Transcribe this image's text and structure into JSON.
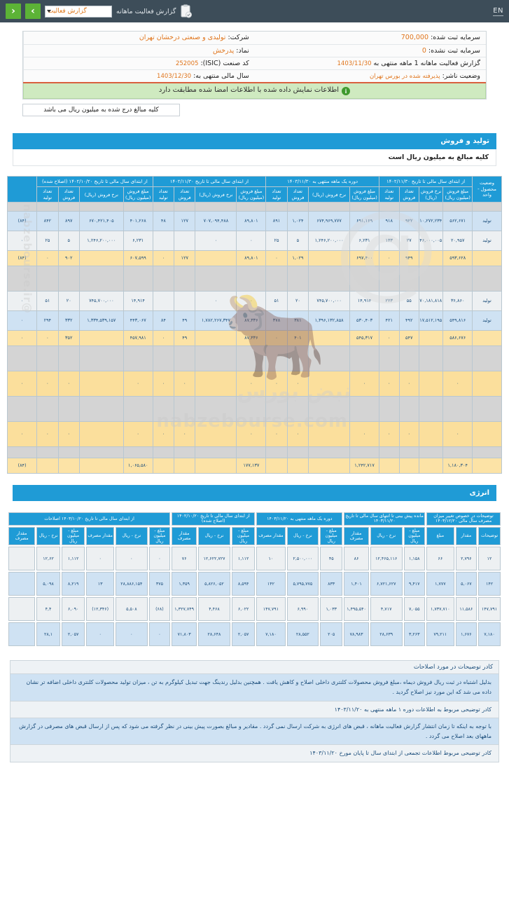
{
  "topbar": {
    "en_label": "EN",
    "title": "گزارش فعالیت ماهانه",
    "select_value": "گزارش فعالیت",
    "prev_label": "‹",
    "next_label": "›",
    "clipboard_icon": "clipboard-check-icon"
  },
  "info": {
    "company_label": "شرکت:",
    "company_value": "تولیدی و صنعتی درخشان تهران",
    "symbol_label": "نماد:",
    "symbol_value": "پدرخش",
    "isic_label": "کد صنعت (ISIC):",
    "isic_value": "252005",
    "fiscal_year_label": "سال مالی منتهی به:",
    "fiscal_year_value": "1403/12/30",
    "registered_capital_label": "سرمایه ثبت شده:",
    "registered_capital_value": "700,000",
    "unregistered_capital_label": "سرمایه ثبت نشده:",
    "unregistered_capital_value": "0",
    "report_period_label": "گزارش فعالیت ماهانه  1 ماهه منتهی به",
    "report_period_value": "1403/11/30",
    "publisher_status_label": "وضعیت ناشر:",
    "publisher_status_value": "پذیرفته شده در بورس تهران",
    "notice": "اطلاعات نمایش داده شده با اطلاعات امضا شده مطابقت دارد",
    "unit_note": "کلیه مبالغ درج شده به میلیون ریال می باشد"
  },
  "production_section": {
    "title": "تولید و فروش",
    "subtitle": "کلیه مبالغ به میلیون ریال است"
  },
  "production_table": {
    "group_headers": [
      "از ابتدای سال مالی تا تاریخ ۱۴۰۲/۱۰/۲۰ (اصلاح شده)",
      "از ابتدای سال مالی تا تاریخ ۱۴۰۲/۱۱/۳۰",
      "دوره یک ماهه منتهی به ۱۴۰۳/۱۱/۳۰",
      "از ابتدای سال مالی تا تاریخ ۱۴۰۲/۱۱/۳۰",
      "وضعیت محصول - واحد"
    ],
    "col_headers": [
      "مبلغ فروش (میلیون ریال)",
      "نرخ فروش (ریال)",
      "تعداد فروش",
      "تعداد تولید",
      "مبلغ فروش (میلیون ریال)",
      "نرخ فروش (ریال)",
      "تعداد فروش",
      "تعداد تولید",
      "مبلغ فروش (میلیون ریال)",
      "نرخ فروش (ریال)",
      "تعداد فروش",
      "تعداد تولید",
      "مبلغ فروش (میلیون ریال)",
      "نرخ فروش (ریال)",
      "تعداد فروش",
      "تعداد تولید",
      "مبلغ فروش (میلیون ریال)"
    ],
    "rows": [
      {
        "type": "spacer"
      },
      {
        "type": "data",
        "style": "blue",
        "cells": [
          "تولید",
          "۵۶۲,۶۷۱",
          "۶۱۰,۲۷۲,۲۳۴",
          "۹۲۲",
          "۹۱۸",
          "۶۹۱,۱۶۹",
          "۶۷۴,۹۶۹,۷۷۷",
          "۱,۰۲۴",
          "۸۹۱",
          "۸۹,۸۰۱",
          "۷۰۷,۰۹۴,۴۸۸",
          "۱۲۷",
          "۴۸",
          "۴۰۱,۲۶۸",
          "۶۷۰,۴۲۱,۴۰۵",
          "۸۹۷",
          "۸۴۲",
          "(۸۴)"
        ]
      },
      {
        "type": "data",
        "style": "white",
        "cells": [
          "تولید",
          "۲۰,۹۵۷",
          "۱,۱۴۶,۰۰۰,۰۰۵",
          "۲۷",
          "۱۳۳",
          "۶,۲۳۱",
          "۱,۲۴۶,۲۰۰,۰۰۰",
          "۵",
          "۲۵",
          "۰",
          "۰",
          "",
          "",
          "۶,۲۳۱",
          "۱,۲۴۶,۲۰۰,۰۰۰",
          "۵",
          "۲۵",
          "۰"
        ]
      },
      {
        "type": "data",
        "style": "yellow",
        "cells": [
          "",
          "۵۹۳,۶۲۸",
          "",
          "۹۴۹",
          "۰",
          "۶۹۷,۴۰۰",
          "",
          "۱,۰۲۹",
          "۰",
          "۸۹,۸۰۱",
          "",
          "۱۲۷",
          "۰",
          "۶۰۷,۵۹۹",
          "",
          "۹۰۲",
          "۰",
          "(۸۴)"
        ]
      },
      {
        "type": "spacer-tall"
      },
      {
        "type": "data",
        "style": "white",
        "cells": [
          "تولید",
          "۳۶,۸۶۰",
          "۶۷۰,۱۸۱,۸۱۸",
          "۵۵",
          "۲۲۳",
          "۱۴,۹۱۴",
          "۷۴۵,۷۰۰,۰۰۰",
          "۲۰",
          "۵۱",
          "۰",
          "۰",
          "",
          "",
          "۱۴,۹۱۴",
          "۷۴۵,۷۰۰,۰۰۰",
          "۲۰",
          "۵۱",
          "۰"
        ]
      },
      {
        "type": "data",
        "style": "blue",
        "cells": [
          "تولید",
          "۵۴۹,۸۱۶",
          "۱,۱۱۷,۵۱۲,۱۹۵",
          "۴۹۲",
          "۴۲۱",
          "۵۳۰,۴۰۳",
          "۱,۳۹۶,۱۳۲,۸۵۸",
          "۳۸۱",
          "۳۷۸",
          "۸۷,۳۳۶",
          "۱,۷۸۲,۲۶۷,۳۴۷",
          "۴۹",
          "۸۴",
          "۴۴۳,۰۶۷",
          "۱,۳۳۴,۵۳۹,۱۵۷",
          "۳۳۲",
          "۲۹۴",
          "۰"
        ]
      },
      {
        "type": "data",
        "style": "yellow",
        "cells": [
          "",
          "۵۸۶,۶۷۶",
          "",
          "۵۴۷",
          "۰",
          "۵۴۵,۳۱۷",
          "",
          "۴۰۱",
          "۰",
          "۸۷,۳۳۶",
          "",
          "۴۹",
          "۰",
          "۴۵۷,۹۸۱",
          "",
          "۳۵۲",
          "۰",
          "۰"
        ]
      },
      {
        "type": "spacer-tall2"
      },
      {
        "type": "data",
        "style": "yellow2",
        "cells": [
          "",
          "۰",
          "",
          "۰",
          "۰",
          "۰",
          "",
          "۰",
          "۰",
          "۰",
          "",
          "۰",
          "۰",
          "۰",
          "",
          "۰",
          "۰",
          "۰"
        ]
      },
      {
        "type": "spacer-tall"
      },
      {
        "type": "data",
        "style": "yellow2b",
        "cells": [
          "",
          "۰",
          "",
          "۰",
          "۰",
          "۰",
          "",
          "۰",
          "۰",
          "۰",
          "",
          "۰",
          "۰",
          "۰",
          "",
          "۰",
          "۰",
          "۰"
        ]
      },
      {
        "type": "spacer-lgrey"
      },
      {
        "type": "total",
        "style": "yellow",
        "cells": [
          "",
          "۱,۱۸۰,۳۰۴",
          "",
          "",
          "",
          "۱,۲۴۲,۷۱۷",
          "",
          "",
          "",
          "۱۷۷,۱۳۷",
          "",
          "",
          "",
          "۱,۰۶۵,۵۸۰",
          "",
          "",
          "",
          "(۸۴)"
        ]
      }
    ]
  },
  "energy_section": {
    "title": "انرژی"
  },
  "energy_table": {
    "group_headers": [
      "از ابتدای سال مالی تا تاریخ ۱۴۰۳/۱۰/۲۰ اصلاحات",
      "از ابتدای سال مالی تا تاریخ ۱۴۰۲/۱۰/۲۰ (اصلاح شده)",
      "دوره یک ماهه منتهی به ۱۴۰۳/۱۱/۲۰",
      "از ابتدای سال مالی تا تاریخ ۱۴۰۳/۱۱/۲۰",
      "مانده پیش بینی تا انتهای سال مالی تا تاریخ ۱۴۰۳/۱۱/۲۰",
      "توضیحات در خصوص تغییر میزان مصرف سال مالی ۱۴۰۳/۱۲/۲۰"
    ],
    "col_headers": [
      "مبلغ - میلیون ریال",
      "نرخ - ریال",
      "مقدار مصرف",
      "مبلغ - میلیون ریال",
      "نرخ - ریال",
      "مقدار مصرف",
      "مبلغ - میلیون ریال",
      "نرخ - ریال",
      "مقدار مصرف",
      "مبلغ - میلیون ریال",
      "نرخ - ریال",
      "مقدار مصرف",
      "مبلغ - میلیون ریال",
      "نرخ - ریال",
      "مقدار مصرف",
      "مبلغ",
      "مقدار",
      "توضیحات"
    ],
    "rows": [
      {
        "style": "a",
        "cells": [
          "۱۲",
          "۲,۷۹۶",
          "۶۶",
          "۱,۱۵۸",
          "۱۲,۴۶۵,۱۱۶",
          "۸۶",
          "۴۵",
          "۲,۵۰۰,۰۰۰",
          "۱۰",
          "۱,۱۱۲",
          "۱۲,۶۲۲,۷۲۷",
          "۷۶",
          "۰",
          "۰",
          "۰",
          "۱,۱۱۲",
          "۱۲,۶۲",
          "",
          ""
        ]
      },
      {
        "style": "b",
        "cells": [
          "۱۴۲",
          "۵,۰۶۷",
          "۱,۷۷۷",
          "۹,۴۱۷",
          "۶,۷۲۱,۶۲۷",
          "۱,۴۰۱",
          "۸۳۳",
          "۵,۷۹۵,۷۷۵",
          "۱۴۲",
          "۸,۵۹۴",
          "۵,۸۲۶,۰۵۲",
          "۱,۳۵۹",
          "۳۷۵",
          "۲۸,۸۸۶,۱۵۴",
          "۱۳",
          "۸,۲۱۹",
          "۵,۰۹۸",
          "",
          ""
        ]
      },
      {
        "style": "a",
        "cells": [
          "۱۴۷,۷۹۱",
          "۱۱,۵۸۶",
          "۱,۷۳۷,۷۱۰",
          "۷,۰۵۵",
          "۴,۷۱۷",
          "۱,۴۹۵,۵۴۰",
          "۱,۰۳۳",
          "۶,۹۹۰",
          "۱۴۷,۷۹۱",
          "۶,۰۲۲",
          "۴,۴۶۸",
          "۱,۳۲۷,۷۴۹",
          "(۶۸)",
          "۵,۵۰۸",
          "(۱۲,۳۴۶)",
          "۶,۰۹۰",
          "۴,۴",
          "",
          ""
        ]
      },
      {
        "style": "b",
        "cells": [
          "۷,۱۸۰",
          "۱,۶۷۶",
          "۷۹,۲۱۱",
          "۳,۲۶۳",
          "۲۸,۶۳۹",
          "۷۸,۹۸۳",
          "۲۰۵",
          "۲۸,۵۵۲",
          "۷,۱۸۰",
          "۲,۰۵۷",
          "۲۸,۶۴۸",
          "۷۱,۸۰۳",
          "۰",
          "۰",
          "۰",
          "۲,۰۵۷",
          "۲۸,۱",
          "",
          ""
        ]
      }
    ]
  },
  "explanations": {
    "header": "کادر توضیحات در مورد اصلاحات",
    "items": [
      "بدلیل اشتباه در ثبت ریال فروش دیماه ،مبلغ فروش محصولات کلنتری داخلی اصلاح و کاهش یافت . همچنین بدلیل رندینگ جهت تبدیل کیلوگرم به تن ، میزان تولید محصولات کلنتری داخلی اضافه تر نشان داده می شد که این مورد نیز اصلاح گردید .",
      "کادر توضیحی مربوط به اطلاعات دوره ۱ ماهه منتهی به ۱۴۰۳/۱۱/۲۰",
      "با توجه به اینکه تا زمان انتشار گزارش فعالیت ماهانه ، قبض های انرژی به شرکت ارسال نمی گردد . مقادیر و مبالغ بصورت پیش بینی در نظر گرفته می شود که پس از ارسال قبض های مصرفی در گزارش ماههای بعد اصلاح می گردد .",
      "کادر توضیحی مربوط اطلاعات تجمعی از ابتدای سال تا پایان مورخ ۱۴۰۳/۱۱/۲۰"
    ]
  },
  "watermark": {
    "site": "nabzebourse.com",
    "brand_fa": "نبض بورس",
    "handle": "@nabzebourse.ir"
  }
}
